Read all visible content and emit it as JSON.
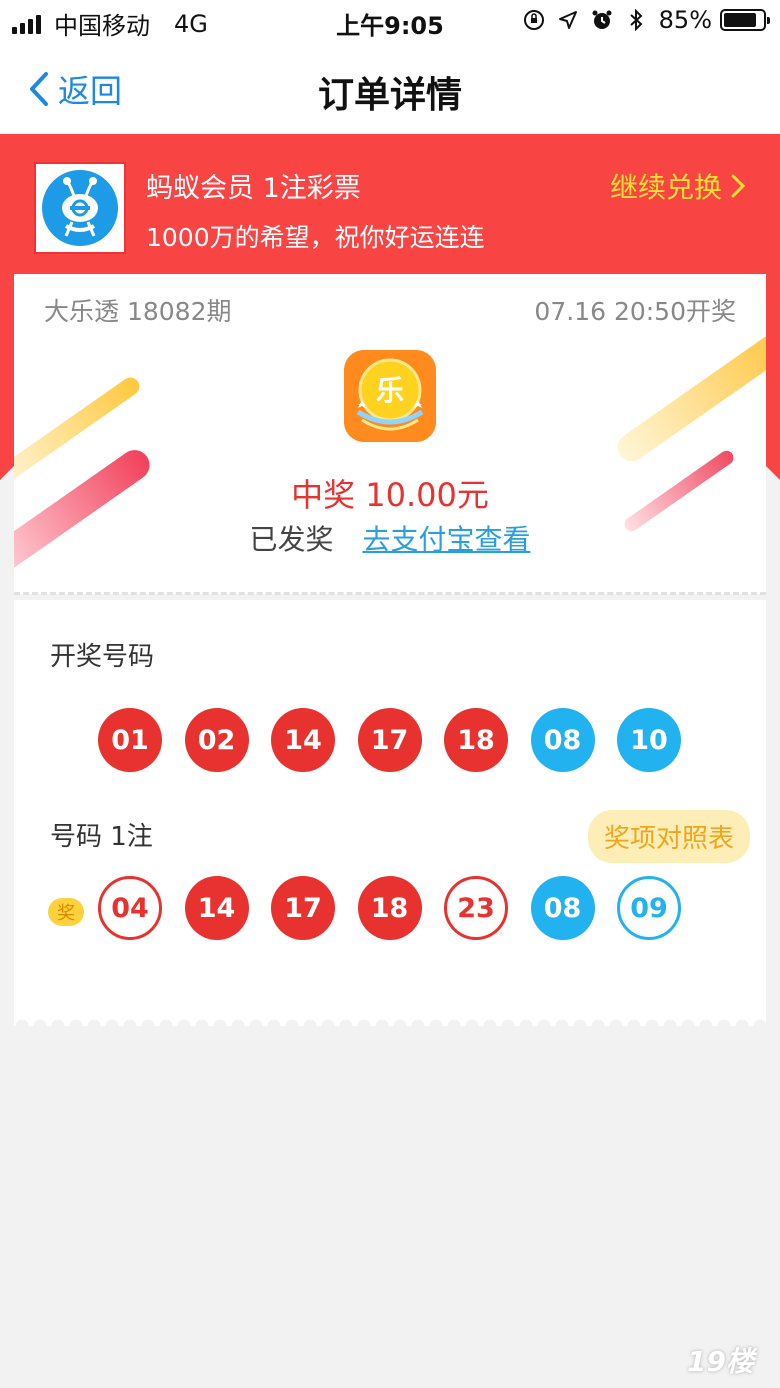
{
  "status_bar": {
    "carrier": "中国移动",
    "network": "4G",
    "time": "上午9:05",
    "battery_percent": "85%",
    "icons": [
      "orientation-lock-icon",
      "location-icon",
      "alarm-icon",
      "bluetooth-icon"
    ],
    "battery_level": 0.85
  },
  "nav": {
    "back_label": "返回",
    "title": "订单详情"
  },
  "promo": {
    "title": "蚂蚁会员 1注彩票",
    "subtitle": "1000万的希望，祝你好运连连",
    "continue_label": "继续兑换"
  },
  "ticket": {
    "issue": "大乐透 18082期",
    "draw_time": "07.16 20:50开奖",
    "logo_char": "乐",
    "prize": "中奖 10.00元",
    "paid_status": "已发奖",
    "alipay_link": "去支付宝查看"
  },
  "draw": {
    "label": "开奖号码",
    "front": [
      "01",
      "02",
      "14",
      "17",
      "18"
    ],
    "back": [
      "08",
      "10"
    ]
  },
  "bet": {
    "label": "号码 1注",
    "prize_table_label": "奖项对照表",
    "win_tag": "奖",
    "numbers": [
      {
        "value": "04",
        "style": "red-outline"
      },
      {
        "value": "14",
        "style": "red"
      },
      {
        "value": "17",
        "style": "red"
      },
      {
        "value": "18",
        "style": "red"
      },
      {
        "value": "23",
        "style": "red-outline"
      },
      {
        "value": "08",
        "style": "blue"
      },
      {
        "value": "09",
        "style": "blue-outline"
      }
    ]
  },
  "colors": {
    "header_red": "#f94444",
    "ball_red": "#e8322f",
    "ball_blue": "#21b2ef",
    "link_blue": "#2a9fe0",
    "accent_yellow": "#ffe033"
  },
  "watermark": "19楼"
}
